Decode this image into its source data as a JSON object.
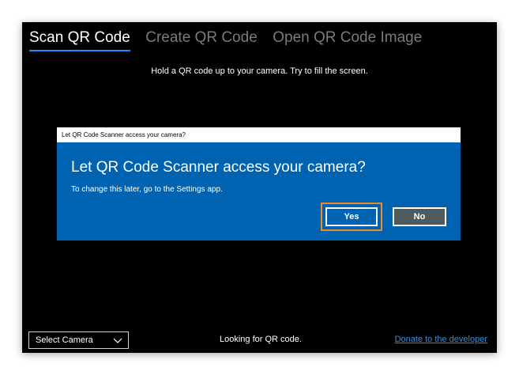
{
  "tabs": [
    {
      "label": "Scan QR Code"
    },
    {
      "label": "Create QR Code"
    },
    {
      "label": "Open QR Code Image"
    }
  ],
  "instruction": "Hold a QR code up to your camera. Try to fill the screen.",
  "dialog": {
    "titlebar": "Let QR Code Scanner access your camera?",
    "heading": "Let QR Code Scanner access your camera?",
    "message": "To change this later, go to the Settings app.",
    "yes_label": "Yes",
    "no_label": "No"
  },
  "footer": {
    "camera_select": "Select Camera",
    "status": "Looking for QR code.",
    "donate_link": "Donate to the developer"
  },
  "colors": {
    "accent": "#1e90ff",
    "dialog_bg": "#0063b1",
    "focus_highlight": "#f08a24",
    "link": "#3a8fd8"
  },
  "icons": {
    "camera_select": "chevron-down-icon"
  }
}
